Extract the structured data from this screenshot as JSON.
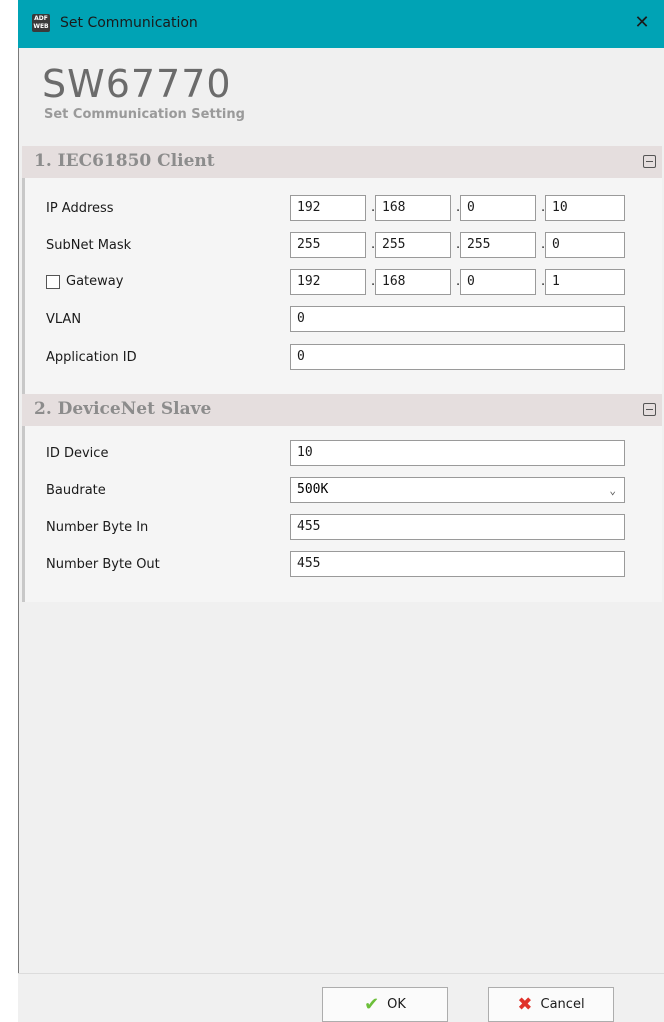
{
  "window": {
    "title": "Set Communication",
    "app_icon_text": "ADF WEB"
  },
  "header": {
    "product": "SW67770",
    "subtitle": "Set Communication Setting"
  },
  "section1": {
    "title": "1. IEC61850 Client",
    "ip_label": "IP Address",
    "ip": [
      "192",
      "168",
      "0",
      "10"
    ],
    "mask_label": "SubNet Mask",
    "mask": [
      "255",
      "255",
      "255",
      "0"
    ],
    "gw_label": "Gateway",
    "gw": [
      "192",
      "168",
      "0",
      "1"
    ],
    "vlan_label": "VLAN",
    "vlan": "0",
    "appid_label": "Application ID",
    "appid": "0"
  },
  "section2": {
    "title": "2. DeviceNet Slave",
    "id_label": "ID Device",
    "id": "10",
    "baud_label": "Baudrate",
    "baud": "500K",
    "in_label": "Number Byte In",
    "in": "455",
    "out_label": "Number Byte Out",
    "out": "455"
  },
  "footer": {
    "ok_label": "OK",
    "cancel_label": "Cancel"
  },
  "dot": "."
}
